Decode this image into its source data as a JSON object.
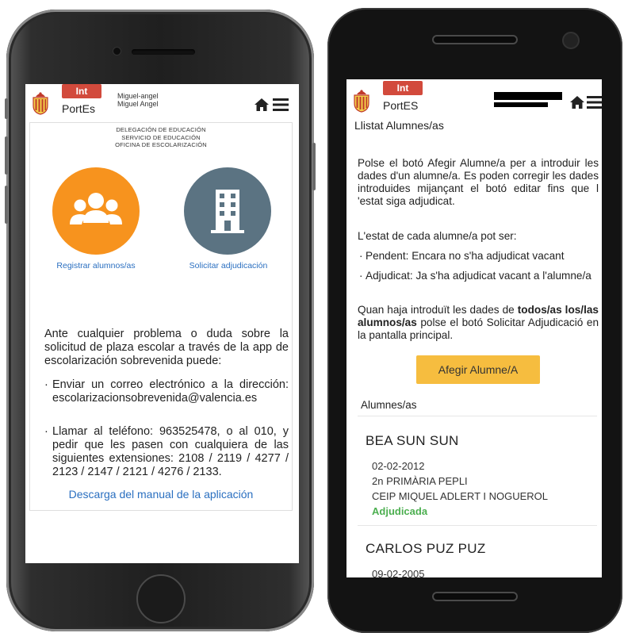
{
  "screen1": {
    "header": {
      "badge": "Int",
      "brand": "PortEs",
      "user_line1": "Miguel-angel",
      "user_line2": "Miguel Angel"
    },
    "agency_lines": [
      "DELEGACIÓN DE EDUCACIÓN",
      "SERVICIO DE EDUCACIÓN",
      "OFICINA DE ESCOLARIZACIÓN"
    ],
    "actions": [
      {
        "label": "Registrar alumnos/as",
        "icon": "users-icon",
        "color": "#f7931e"
      },
      {
        "label": "Solicitar adjudicación",
        "icon": "building-icon",
        "color": "#5b7382"
      }
    ],
    "intro": "Ante cualquier problema o duda sobre la solicitud de plaza escolar a través de la app de escolarización sobrevenida puede:",
    "bullets": [
      "Enviar un correo electrónico a la dirección: escolarizacionsobrevenida@valencia.es",
      "Llamar al teléfono: 963525478, o al 010, y pedir que les pasen con cualquiera de las siguientes extensiones: 2108 / 2119 / 4277 / 2123 / 2147 / 2121 / 4276 / 2133."
    ],
    "manual_link": "Descarga del manual de la aplicación"
  },
  "screen2": {
    "header": {
      "badge": "Int",
      "brand": "PortES"
    },
    "title": "Llistat Alumnes/as",
    "para1": "Polse el botó Afegir Alumne/a per a introduir les dades d'un alumne/a. Es poden corregir les dades introduides mijançant el botó editar fins que l 'estat siga adjudicat.",
    "para2": "L'estat de cada alumne/a pot ser:",
    "bullets": [
      "Pendent: Encara no s'ha adjudicat vacant",
      "Adjudicat: Ja s'ha adjudicat vacant a l'alumne/a"
    ],
    "para3_before": "Quan haja introduït les dades de ",
    "para3_bold": "todos/as los/las alumnos/as",
    "para3_after": " polse el botó Solicitar Adjudicació en la pantalla principal.",
    "add_button": "Afegir Alumne/A",
    "list_header": "Alumnes/as",
    "students": [
      {
        "name": "BEA SUN SUN",
        "birth": "02-02-2012",
        "course": "2n PRIMÀRIA PEPLI",
        "school": "CEIP MIQUEL ADLERT I NOGUEROL",
        "status": "Adjudicada"
      },
      {
        "name": "CARLOS PUZ PUZ",
        "birth": "09-02-2005"
      }
    ]
  },
  "colors": {
    "badge_red": "#d24a3c",
    "orange": "#f7931e",
    "slate": "#5b7382",
    "link_blue": "#2a6fc0",
    "button_yellow": "#f6bd3f",
    "status_green": "#4caf50"
  }
}
